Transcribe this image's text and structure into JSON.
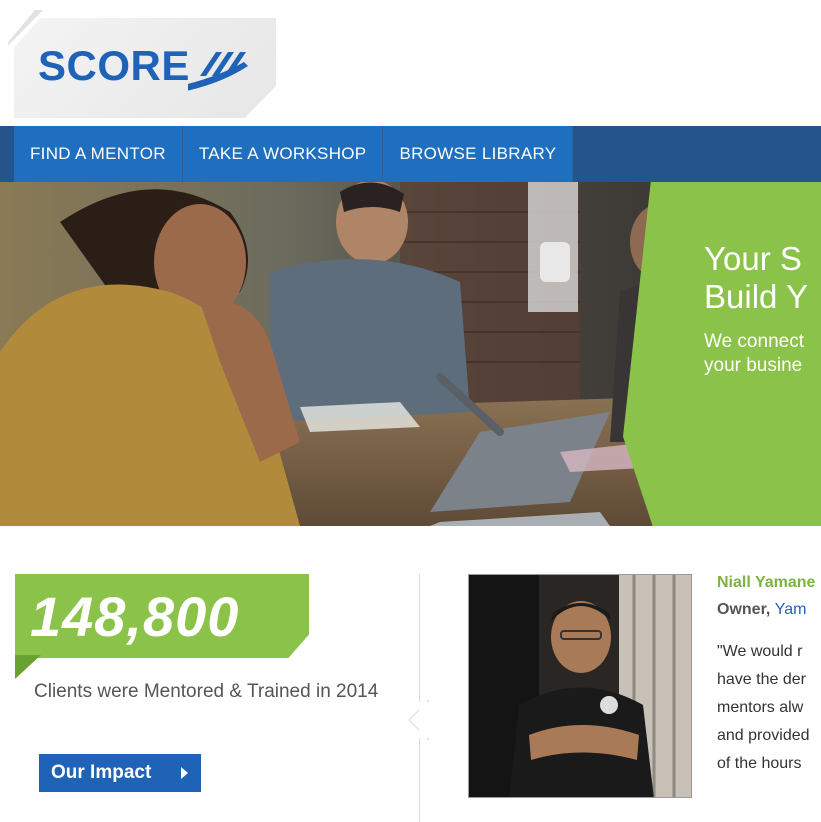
{
  "brand": {
    "name": "SCORE",
    "logo_color": "#1f63b6"
  },
  "nav": {
    "items": [
      {
        "label": "FIND A MENTOR"
      },
      {
        "label": "TAKE A WORKSHOP"
      },
      {
        "label": "BROWSE LIBRARY"
      }
    ],
    "bar_color": "#24548c",
    "item_color": "#1e6fbf"
  },
  "hero": {
    "title_line1": "Your S",
    "title_line2": "Build Y",
    "sub_line1": "We connect",
    "sub_line2": "your busine",
    "accent_color": "#8bc34a"
  },
  "stats": {
    "number": "148,800",
    "description": "Clients were Mentored & Trained in 2014",
    "button_label": "Our Impact"
  },
  "testimonial": {
    "name": "Niall Yamane",
    "role_prefix": "Owner, ",
    "role_link": "Yam",
    "quote_lines": [
      "\"We would r",
      "have the der",
      "mentors alw",
      "and provided",
      "of the hours"
    ]
  }
}
